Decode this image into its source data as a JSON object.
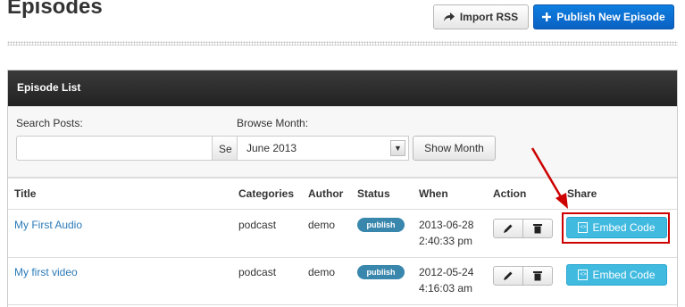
{
  "page_title": "Episodes",
  "toolbar": {
    "import_label": "Import RSS",
    "publish_label": "Publish New Episode"
  },
  "panel": {
    "title": "Episode List"
  },
  "filters": {
    "search_label": "Search Posts:",
    "search_value": "",
    "search_button": "Se",
    "browse_label": "Browse Month:",
    "month_value": "June 2013",
    "show_label": "Show Month"
  },
  "table": {
    "headers": [
      "Title",
      "Categories",
      "Author",
      "Status",
      "When",
      "Action",
      "Share"
    ],
    "rows": [
      {
        "title": "My First Audio",
        "category": "podcast",
        "author": "demo",
        "status": "publish",
        "date": "2013-06-28",
        "time": "2:40:33 pm",
        "share": "Embed Code"
      },
      {
        "title": "My first video",
        "category": "podcast",
        "author": "demo",
        "status": "publish",
        "date": "2012-05-24",
        "time": "4:16:03 am",
        "share": "Embed Code"
      }
    ]
  },
  "colors": {
    "publish_button": "#0a6ed1",
    "badge": "#3a87ad",
    "embed": "#41bae0",
    "link": "#2a7ab8",
    "highlight": "#cc0000"
  },
  "icons": [
    "share-icon",
    "plus-icon",
    "chevron-down-icon",
    "pencil-icon",
    "trash-icon",
    "embed-icon",
    "arrow-annotation"
  ]
}
